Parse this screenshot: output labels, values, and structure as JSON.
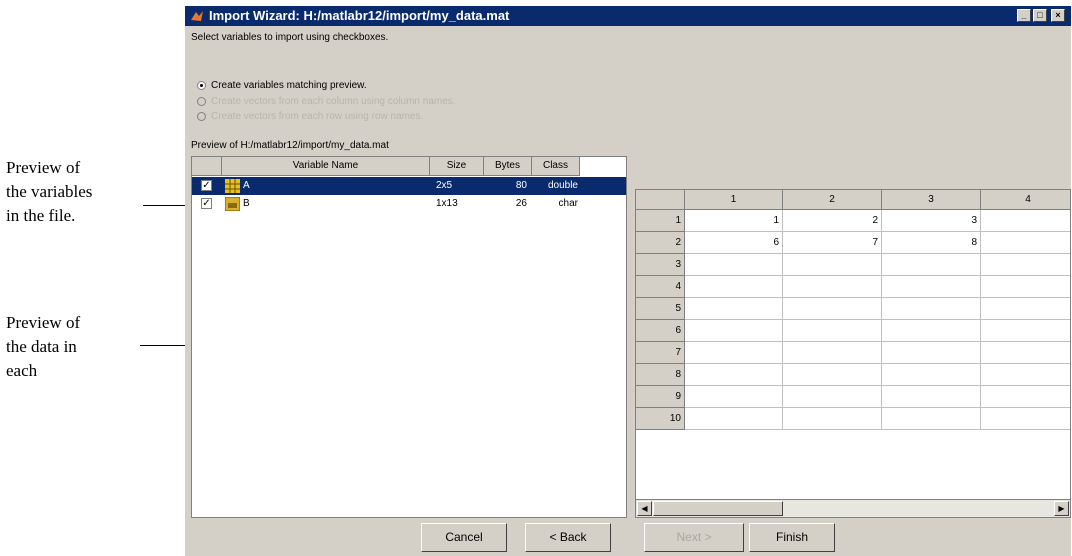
{
  "callouts": {
    "variables": [
      "Preview of",
      "the variables",
      "in the file."
    ],
    "data": [
      "Preview of",
      "the data in",
      "each"
    ]
  },
  "window": {
    "title": "Import Wizard: H:/matlabr12/import/my_data.mat",
    "instructions": "Select variables to import using checkboxes.",
    "options": [
      {
        "label": "Create variables matching preview.",
        "selected": true,
        "enabled": true
      },
      {
        "label": "Create vectors from each column using column names.",
        "selected": false,
        "enabled": false
      },
      {
        "label": "Create vectors from each row using row names.",
        "selected": false,
        "enabled": false
      }
    ],
    "preview_label": "Preview of H:/matlabr12/import/my_data.mat"
  },
  "variables": {
    "columns": [
      "Variable Name",
      "Size",
      "Bytes",
      "Class"
    ],
    "rows": [
      {
        "checked": true,
        "name": "A",
        "size": "2x5",
        "bytes": "80",
        "class": "double",
        "selected": true,
        "icon": "matrix-icon"
      },
      {
        "checked": true,
        "name": "B",
        "size": "1x13",
        "bytes": "26",
        "class": "char",
        "selected": false,
        "icon": "char-icon"
      }
    ]
  },
  "data_grid": {
    "columns": [
      "1",
      "2",
      "3",
      "4"
    ],
    "row_numbers": [
      "1",
      "2",
      "3",
      "4",
      "5",
      "6",
      "7",
      "8",
      "9",
      "10"
    ],
    "rows": [
      [
        "1",
        "2",
        "3",
        ""
      ],
      [
        "6",
        "7",
        "8",
        ""
      ]
    ]
  },
  "buttons": {
    "cancel": "Cancel",
    "back": "< Back",
    "next": "Next >",
    "finish": "Finish"
  },
  "colors": {
    "title_bar": "#0a2a6e",
    "selection": "#0a2a6e",
    "dialog_bg": "#d4d0c8"
  }
}
